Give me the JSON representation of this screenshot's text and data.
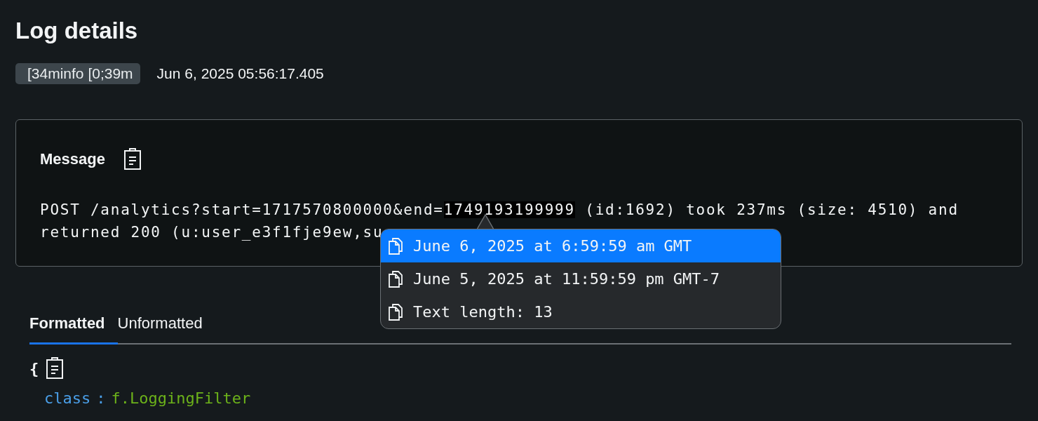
{
  "title": "Log details",
  "level_badge": "[34minfo [0;39m",
  "timestamp": "Jun 6, 2025 05:56:17.405",
  "message": {
    "heading": "Message",
    "line_1_before": "POST /analytics?start=1717570800000&end=",
    "line_1_highlight": "1749193199999",
    "line_1_after": " (id:1692) took 237ms (size: 4510) and",
    "line_2": "returned 200 (u:user_e3f1fje9ew,su"
  },
  "popup_menu": [
    {
      "label": "June 6, 2025 at 6:59:59 am GMT",
      "selected": true
    },
    {
      "label": "June 5, 2025 at 11:59:59 pm GMT-7",
      "selected": false
    },
    {
      "label": "Text length: 13",
      "selected": false
    }
  ],
  "tabs": [
    {
      "label": "Formatted",
      "selected": true
    },
    {
      "label": "Unformatted",
      "selected": false
    }
  ],
  "json_view": {
    "open_brace": "{",
    "fields": [
      {
        "key": "class",
        "separator": ":",
        "value": "f.LoggingFilter"
      }
    ]
  }
}
